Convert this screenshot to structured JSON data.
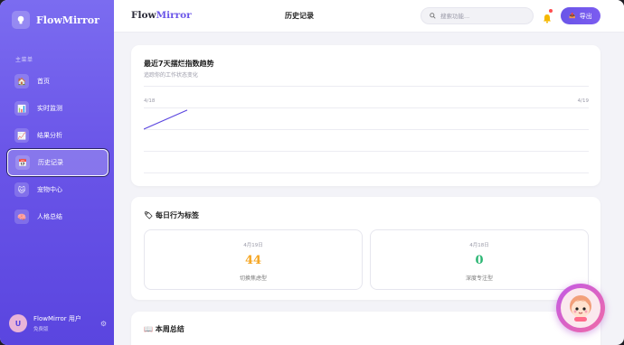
{
  "app": {
    "brand_left": "Flow",
    "brand_right": "Mirror"
  },
  "sidebar": {
    "logo_text": "FlowMirror",
    "menu_title": "主菜单",
    "items": [
      {
        "label": "首页",
        "icon": "home-icon",
        "glyph": "🏠"
      },
      {
        "label": "实时监测",
        "icon": "monitor-chart-icon",
        "glyph": "📊"
      },
      {
        "label": "结果分析",
        "icon": "analysis-chart-icon",
        "glyph": "📈"
      },
      {
        "label": "历史记录",
        "icon": "calendar-icon",
        "glyph": "📅"
      },
      {
        "label": "宠物中心",
        "icon": "pet-icon",
        "glyph": "🐱"
      },
      {
        "label": "人格总结",
        "icon": "brain-icon",
        "glyph": "🧠"
      }
    ],
    "active_index": 3,
    "user": {
      "avatar_letter": "U",
      "name": "FlowMirror 用户",
      "role": "免费版"
    }
  },
  "topbar": {
    "page_title": "历史记录",
    "search_placeholder": "搜索功能...",
    "export_label": "导出"
  },
  "trend_card": {
    "title": "最近7天摆烂指数趋势",
    "subtitle": "追踪你的工作状态变化"
  },
  "chart_data": {
    "type": "line",
    "x": [
      "4/18",
      "4/19"
    ],
    "series": [
      {
        "values": [
          44,
          0
        ]
      }
    ],
    "tick_labels": [
      "4/18",
      "4/19"
    ],
    "grid": true,
    "line_color": "#5a45df"
  },
  "tags_card": {
    "title_icon": "🏷",
    "title": "每日行为标签",
    "tags": [
      {
        "date": "4月19日",
        "value": "44",
        "label": "切换焦虑型",
        "color": "#f5a623"
      },
      {
        "date": "4月18日",
        "value": "0",
        "label": "深度专注型",
        "color": "#2bb673"
      }
    ]
  },
  "weekly_card": {
    "title_icon": "📖",
    "title": "本周总结"
  },
  "colors": {
    "accent": "#6a55e8",
    "sidebar_top": "#7b6cf0",
    "sidebar_bottom": "#5a45df"
  }
}
